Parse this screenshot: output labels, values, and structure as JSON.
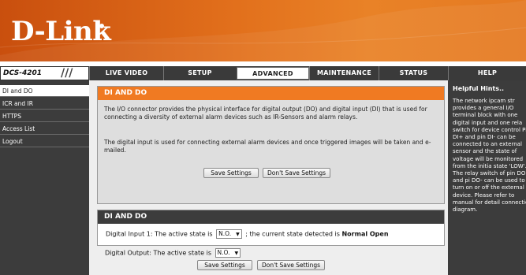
{
  "brand": {
    "logo_text": "D-Link"
  },
  "device": {
    "model": "DCS-4201"
  },
  "nav": {
    "tabs": [
      {
        "label": "LIVE VIDEO"
      },
      {
        "label": "SETUP"
      },
      {
        "label": "ADVANCED"
      },
      {
        "label": "MAINTENANCE"
      },
      {
        "label": "STATUS"
      },
      {
        "label": "HELP"
      }
    ],
    "active_tab": "ADVANCED"
  },
  "sidebar": {
    "items": [
      {
        "label": "DI and DO"
      },
      {
        "label": "ICR and IR"
      },
      {
        "label": "HTTPS"
      },
      {
        "label": "Access List"
      },
      {
        "label": "Logout"
      }
    ],
    "active_item": "DI and DO"
  },
  "section1": {
    "title": "DI AND DO",
    "desc1": "The I/O connector provides the physical interface for digital output (DO) and digital input (DI) that is used for connecting a diversity of external alarm devices such as IR-Sensors and alarm relays.",
    "desc2": "The digital input is used for connecting external alarm devices and once triggered images will be taken and e-mailed.",
    "save_label": "Save Settings",
    "dont_save_label": "Don't Save Settings"
  },
  "section2": {
    "title": "DI AND DO",
    "di_prefix": "Digital Input 1: The active state is",
    "di_value": "N.O.",
    "di_mid": "; the current state detected is",
    "di_state": "Normal Open",
    "do_prefix": "Digital Output: The active state is",
    "do_value": "N.O."
  },
  "bottom": {
    "save_label": "Save Settings",
    "dont_save_label": "Don't Save Settings"
  },
  "hints": {
    "title": "Helpful Hints..",
    "body": "The network ipcam str provides a general I/O terminal block with one digital input and one rela switch for device control Pin DI+ and pin DI- can be connected to an external sensor and the state of voltage will be monitored from the initia state 'LOW'. The relay switch of pin DO+ and pi DO- can be used to turn on or off the external device. Please refer to manual for detail connection diagram."
  },
  "colors": {
    "accent": "#f07a22",
    "dark": "#3c3c3c"
  },
  "icons": [
    "dropdown-arrow-icon"
  ]
}
